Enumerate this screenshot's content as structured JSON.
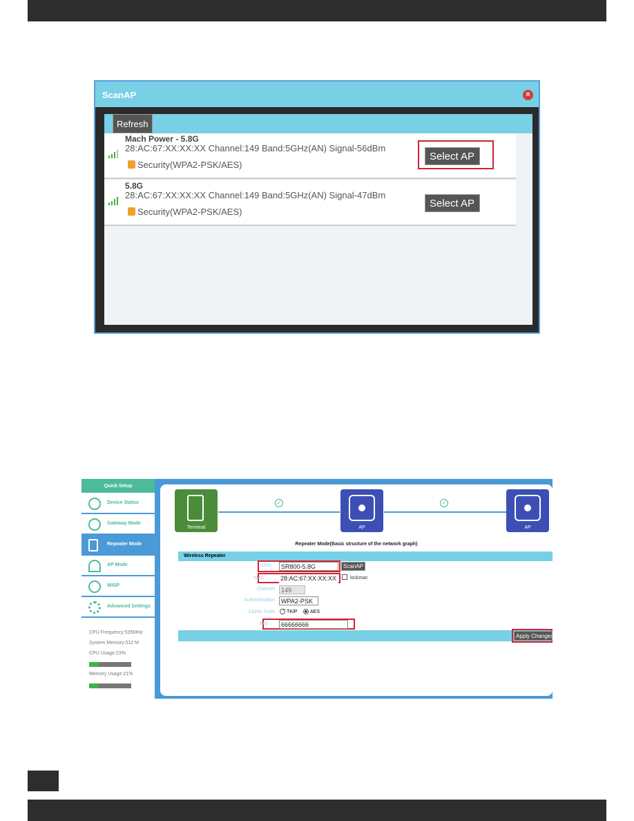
{
  "scanap": {
    "title": "ScanAP",
    "close_icon": "close-icon",
    "refresh": "Refresh",
    "networks": [
      {
        "name": "Mach Power - 5.8G",
        "info": "28:AC:67:XX:XX:XX Channel:149 Band:5GHz(AN) Signal-56dBm",
        "security": "Security(WPA2-PSK/AES)",
        "button": "Select AP",
        "highlighted": true
      },
      {
        "name": "5.8G",
        "info": "28:AC:67:XX:XX:XX Channel:149 Band:5GHz(AN) Signal-47dBm",
        "security": "Security(WPA2-PSK/AES)",
        "button": "Select AP",
        "highlighted": false
      }
    ]
  },
  "router": {
    "sidebar": {
      "header": "Quick Setup",
      "items": [
        {
          "label": "Device Status"
        },
        {
          "label": "Gateway Mode"
        },
        {
          "label": "Repeater Mode",
          "active": true
        },
        {
          "label": "AP Mode"
        },
        {
          "label": "WISP"
        },
        {
          "label": "Advanced Settings"
        }
      ]
    },
    "stats": {
      "cpu_freq": "CPU Frequency:535MHz",
      "memory": "System Memory:512 M",
      "cpu_usage": "CPU Usage:23%",
      "cpu_percent": 23,
      "mem_usage": "Memory Usage:21%",
      "mem_percent": 21
    },
    "diagram": {
      "terminal": "Terminal",
      "ap1": "AP",
      "ap2": "AP",
      "caption": "Repeater Mode(Basic structure of the network graph)"
    },
    "form": {
      "section": "Wireless Repeater",
      "ssid_label": "SSID",
      "ssid": "SR800-5.8G",
      "scan_button": "ScanAP",
      "mac_label": "MAC",
      "mac": "28:AC:67:XX:XX:XX",
      "lockmac": "lockmac",
      "channel_label": "Channel",
      "channel": "149",
      "auth_label": "Authentication",
      "auth": "WPA2-PSK",
      "cipher_label": "Cipher Suite",
      "tkip": "TKIP",
      "aes": "AES",
      "cipher_selected": "AES",
      "key_label": "Key",
      "key": "66666666",
      "apply": "Apply Changes"
    }
  },
  "colors": {
    "accent": "#78d0e6",
    "sidebar_green": "#4bbb9b",
    "highlight_red": "#d42030",
    "ap_blue": "#3d4fb5",
    "terminal_green": "#4a8c3a"
  }
}
